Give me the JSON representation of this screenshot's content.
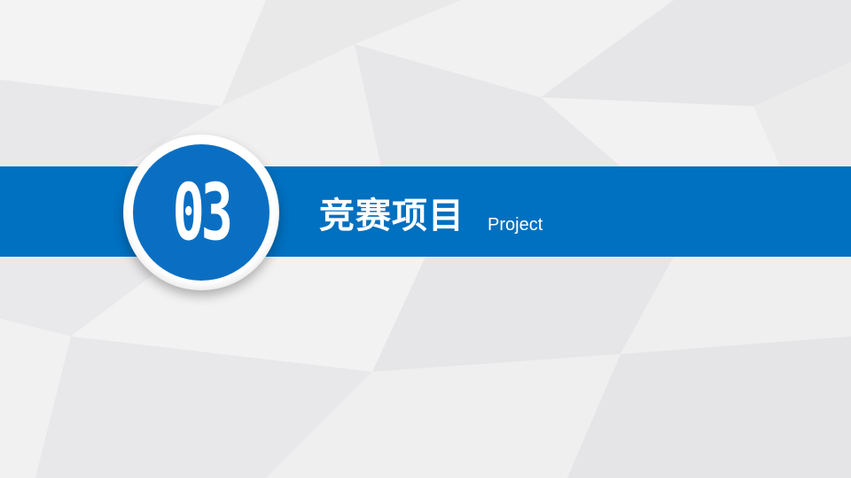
{
  "section": {
    "number": "03",
    "title": "竞赛项目",
    "subtitle": "Project"
  },
  "colors": {
    "accent": "#0070c0",
    "background": "#eeeeef",
    "text": "#ffffff"
  }
}
